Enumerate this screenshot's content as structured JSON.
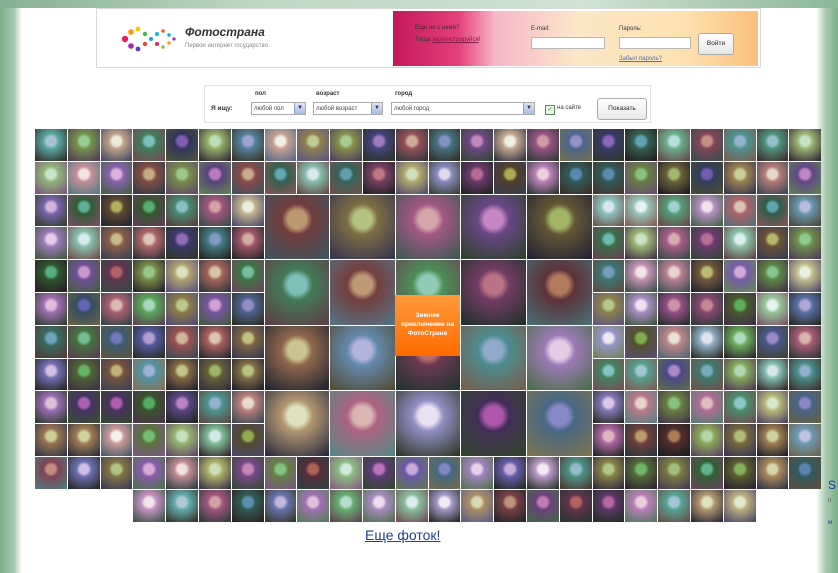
{
  "header": {
    "brand": "Фотострана",
    "tagline": "Первое интернет государство"
  },
  "login": {
    "question": "Еще не с нами?",
    "register_prefix": "Тогда ",
    "register_link": "зарегистрируйся",
    "register_suffix": "!",
    "email_label": "E-mail:",
    "email_value": "",
    "password_label": "Пароль:",
    "password_value": "",
    "login_button": "Войти",
    "forgot_link": "Забыл пароль?"
  },
  "search": {
    "label": "Я ищу:",
    "gender_label": "пол",
    "gender_value": "любой пол",
    "age_label": "возраст",
    "age_value": "любой возраст",
    "city_label": "город",
    "city_value": "любой город",
    "online_checked": true,
    "online_label": "на сайте",
    "show_button": "Показать"
  },
  "promo": {
    "text": "Зимнее приключение на ФотоСтране"
  },
  "more_link": "Еще фоток!",
  "edge": {
    "letter": "S",
    "small1": "п",
    "small2": "м"
  },
  "colors": {
    "bg_green": "#7fae8a",
    "login_grad_start": "#c2185b",
    "login_grad_end": "#f9c07a",
    "link_blue": "#1f3e8c",
    "promo_orange": "#ff6a00"
  }
}
